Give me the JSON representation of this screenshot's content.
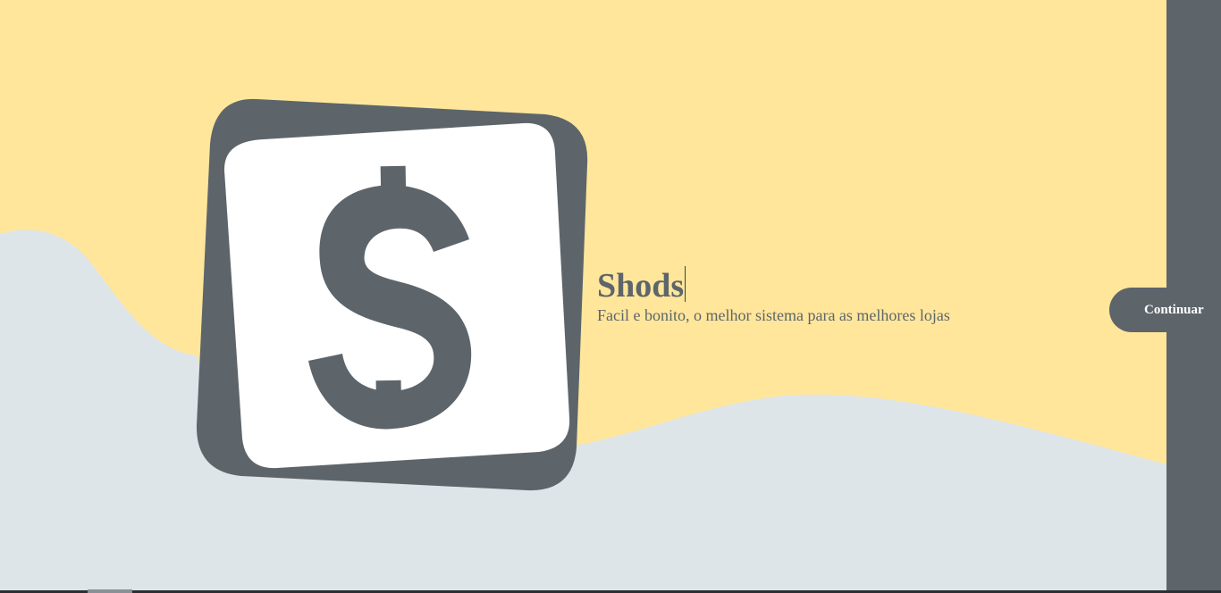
{
  "hero": {
    "title": "Shods",
    "subtitle": "Facil e bonito, o melhor sistema para as melhores lojas",
    "continue_label": "Continuar"
  },
  "logo": {
    "icon": "dollar-sign-icon",
    "symbol": "$"
  },
  "colors": {
    "background_yellow": "#ffe69b",
    "wave_gray": "#dee5e9",
    "dark_slate": "#5d656b",
    "white": "#ffffff"
  }
}
